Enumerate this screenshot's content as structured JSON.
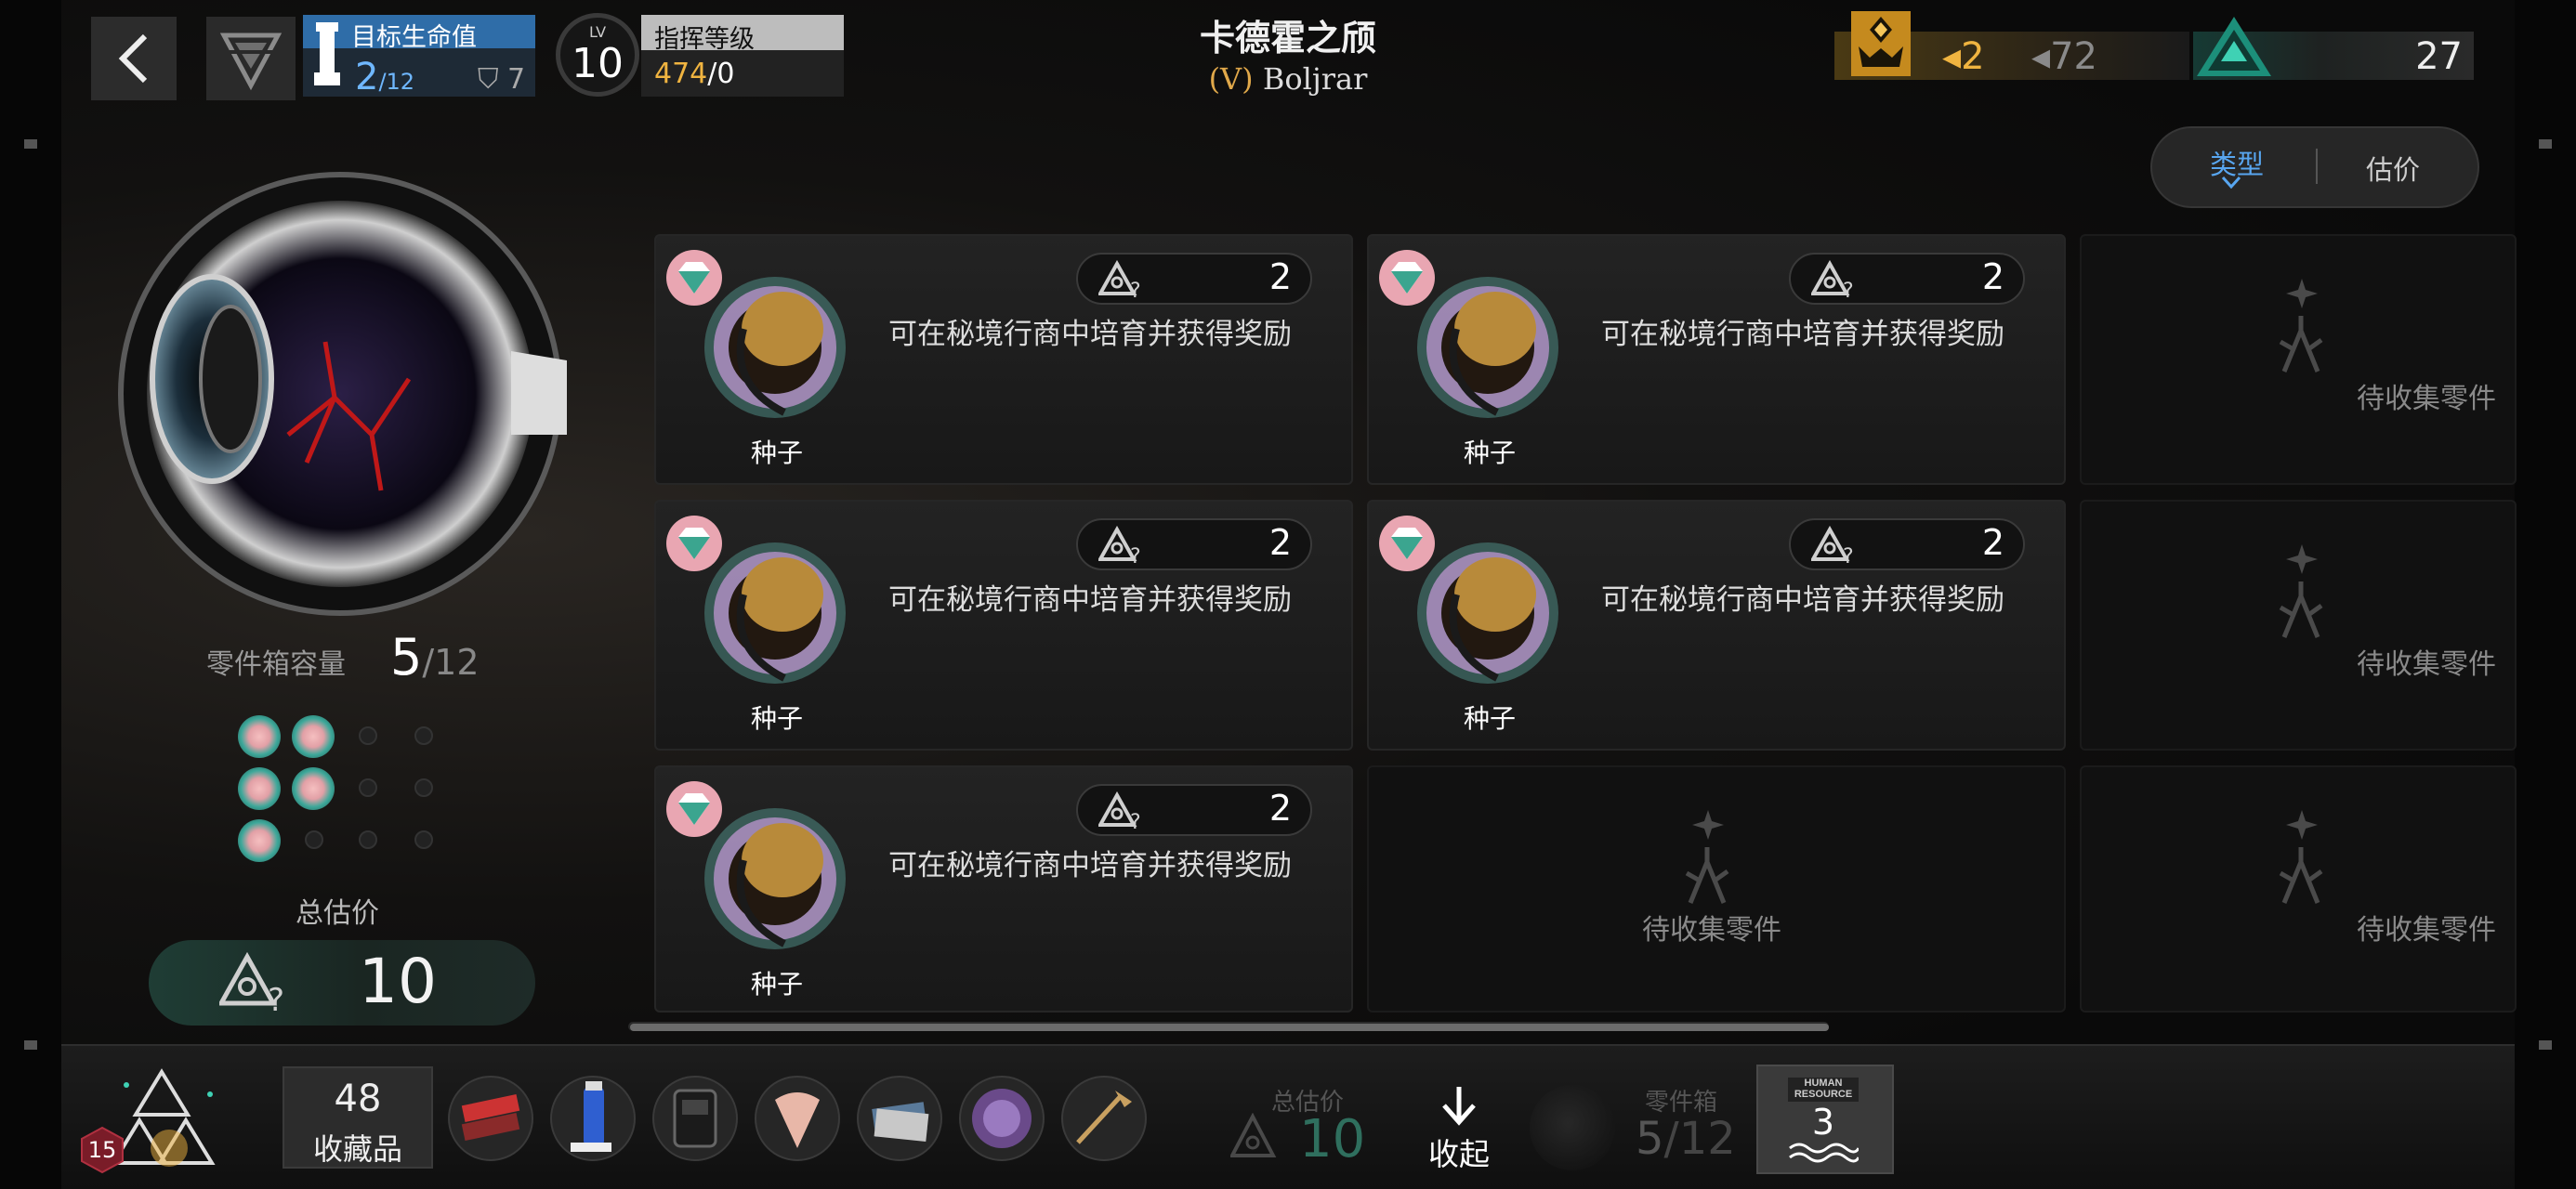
{
  "header": {
    "target": {
      "title": "目标生命值",
      "current": "2",
      "max": "/12",
      "shield": "7"
    },
    "level": {
      "prefix": "LV",
      "value": "10"
    },
    "command": {
      "title": "指挥等级",
      "value_highlight": "474",
      "value_rest": "/0"
    },
    "stage_title": "卡德霍之颀",
    "stage_sub_prefix": "(V)",
    "stage_sub_name": "Boljrar",
    "resources": {
      "gold_a": "◂2",
      "gold_b": "◂72",
      "teal": "27"
    },
    "sort": {
      "type_label": "类型",
      "estimate_label": "估价",
      "active": "type"
    }
  },
  "left_panel": {
    "capacity_label": "零件箱容量",
    "capacity_current": "5",
    "capacity_max": "/12",
    "slots_filled": 5,
    "slots_total": 12,
    "total_label": "总估价",
    "total_value": "10"
  },
  "grid": {
    "cards": [
      {
        "name": "种子",
        "value": "2",
        "desc": "可在秘境行商中培育并获得奖励"
      },
      {
        "name": "种子",
        "value": "2",
        "desc": "可在秘境行商中培育并获得奖励"
      },
      {
        "pending": "待收集零件"
      },
      {
        "name": "种子",
        "value": "2",
        "desc": "可在秘境行商中培育并获得奖励"
      },
      {
        "name": "种子",
        "value": "2",
        "desc": "可在秘境行商中培育并获得奖励"
      },
      {
        "pending": "待收集零件"
      },
      {
        "name": "种子",
        "value": "2",
        "desc": "可在秘境行商中培育并获得奖励"
      },
      {
        "pending": "待收集零件"
      },
      {
        "pending": "待收集零件"
      }
    ]
  },
  "bottom_bar": {
    "rank_level": "15",
    "collection_count": "48",
    "collection_label": "收藏品",
    "collection_items": [
      "chocolate-bars",
      "spray-bottle",
      "radio-device",
      "feather-fan",
      "cards-stack",
      "purple-fur",
      "horn"
    ],
    "estimate_label": "总估价",
    "estimate_value": "10",
    "collapse_label": "收起",
    "box_label": "零件箱",
    "box_current": "5",
    "box_max": "/12",
    "hr_brand_line1": "HUMAN",
    "hr_brand_line2": "RESOURCE",
    "hr_count": "3"
  },
  "colors": {
    "accent_blue": "#2f6da8",
    "gold": "#f0b440",
    "teal": "#3da89a",
    "seed_glow": "#e2a0a6"
  }
}
